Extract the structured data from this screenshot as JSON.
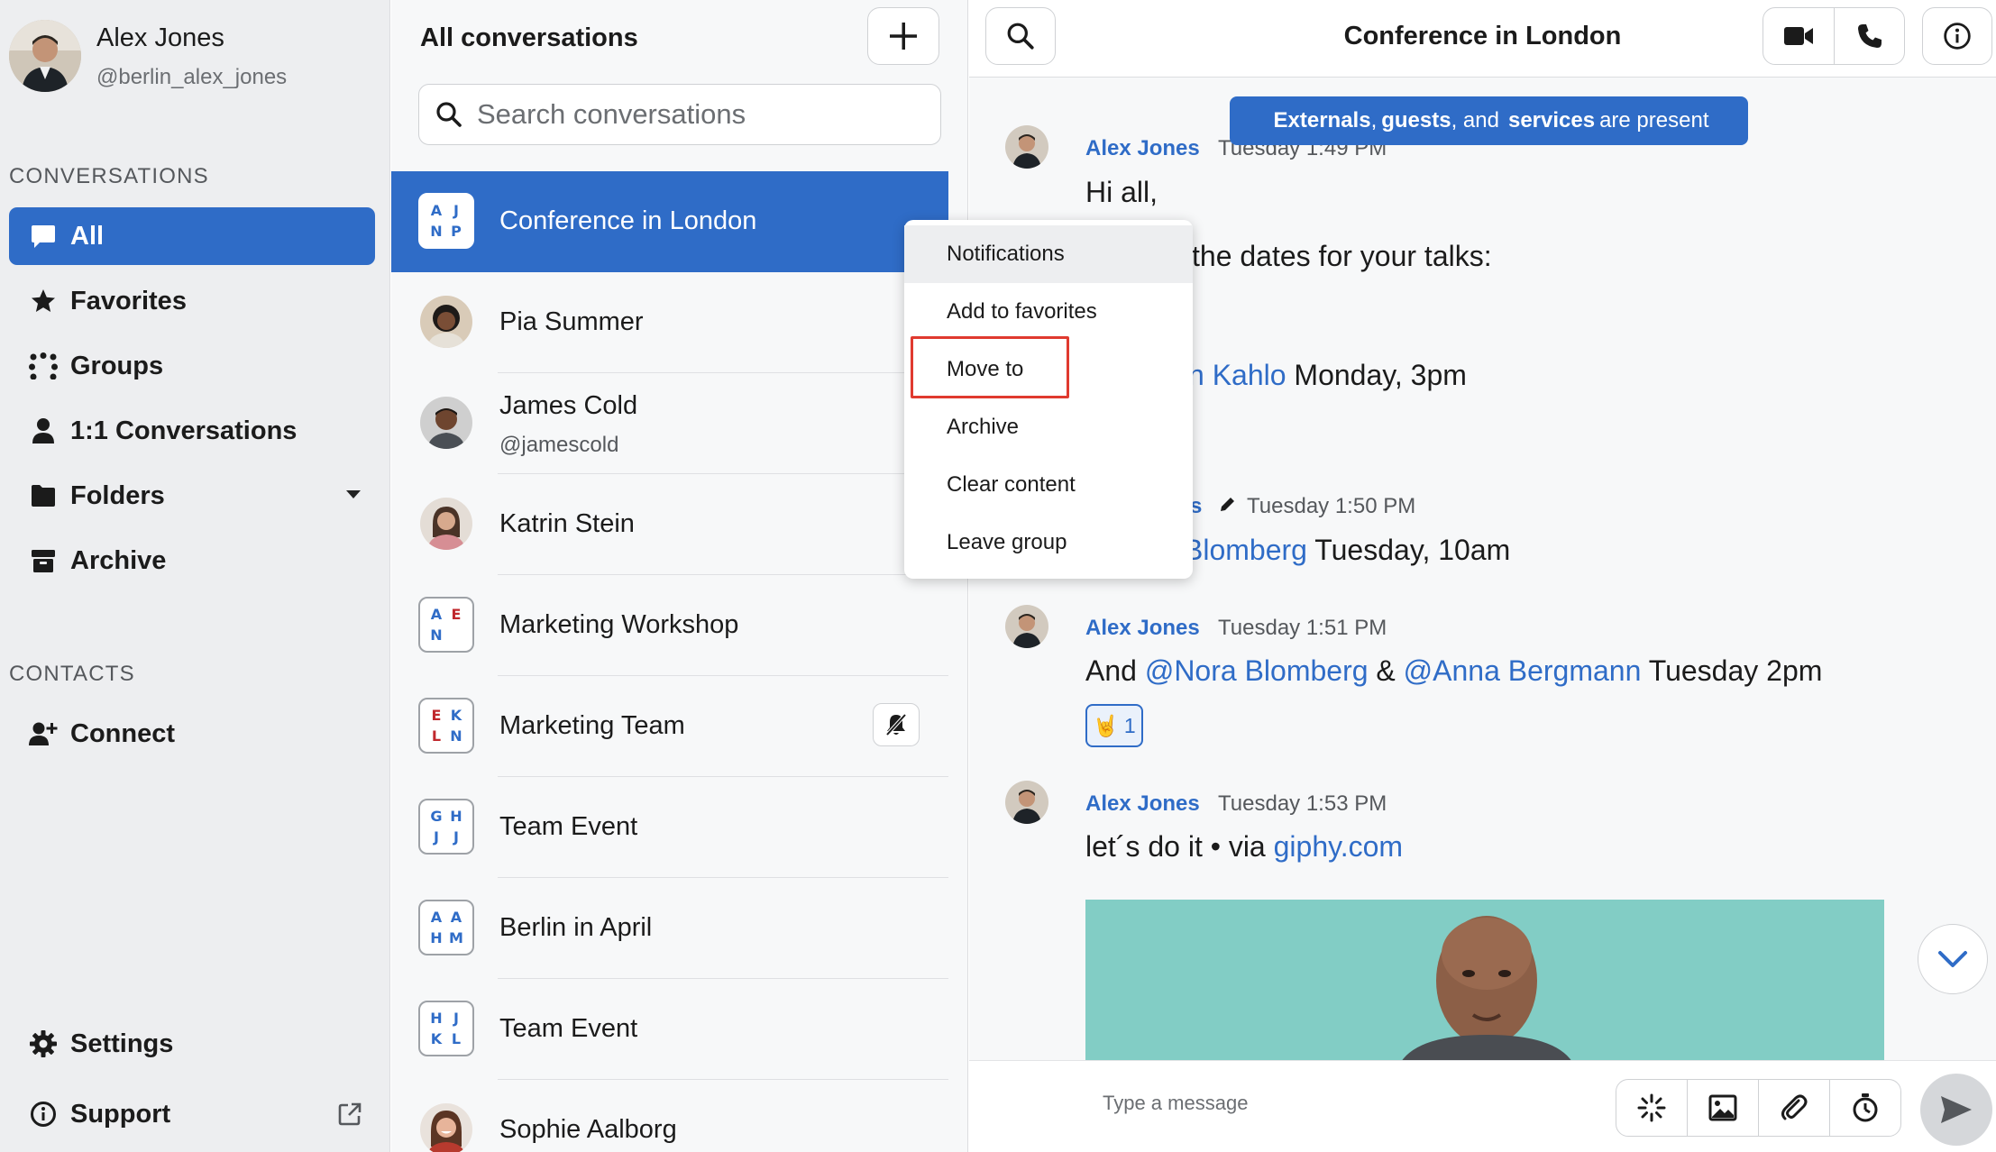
{
  "profile": {
    "name": "Alex Jones",
    "handle": "@berlin_alex_jones"
  },
  "sidebar": {
    "conversations_label": "CONVERSATIONS",
    "items": [
      {
        "label": "All",
        "icon": "chat-bubble-icon",
        "active": true
      },
      {
        "label": "Favorites",
        "icon": "star-icon"
      },
      {
        "label": "Groups",
        "icon": "groups-icon"
      },
      {
        "label": "1:1 Conversations",
        "icon": "person-icon"
      },
      {
        "label": "Folders",
        "icon": "folder-icon"
      },
      {
        "label": "Archive",
        "icon": "archive-icon"
      }
    ],
    "contacts_label": "CONTACTS",
    "connect_label": "Connect",
    "settings_label": "Settings",
    "support_label": "Support"
  },
  "list": {
    "title": "All conversations",
    "search_placeholder": "Search conversations",
    "conversations": [
      {
        "name": "Conference in London",
        "initials": [
          "A",
          "J",
          "N",
          "P"
        ],
        "active": true
      },
      {
        "name": "Pia Summer"
      },
      {
        "name": "James Cold",
        "sub": "@jamescold"
      },
      {
        "name": "Katrin Stein"
      },
      {
        "name": "Marketing Workshop",
        "initials": [
          "A",
          "E",
          "N",
          ""
        ]
      },
      {
        "name": "Marketing Team",
        "initials": [
          "E",
          "K",
          "L",
          "N"
        ],
        "muted": true
      },
      {
        "name": "Team Event",
        "initials": [
          "G",
          "H",
          "J",
          "J"
        ]
      },
      {
        "name": "Berlin in April",
        "initials": [
          "A",
          "A",
          "H",
          "M"
        ]
      },
      {
        "name": "Team Event",
        "initials": [
          "H",
          "J",
          "K",
          "L"
        ]
      },
      {
        "name": "Sophie Aalborg"
      }
    ]
  },
  "chat": {
    "title": "Conference in London",
    "banner": {
      "w1": "Externals",
      "sep1": ",",
      "w2": "guests",
      "sep2": ", and",
      "w3": "services",
      "tail": "are present"
    },
    "messages": [
      {
        "author": "Alex Jones",
        "time": "Tuesday 1:49 PM",
        "line1": "Hi all,",
        "line2": "the dates for your talks:",
        "line3_mention": "h Kahlo",
        "line3_rest": "Monday, 3pm"
      },
      {
        "author_partial": "s",
        "time": "Tuesday 1:50 PM",
        "mention": "Blomberg",
        "rest": "Tuesday, 10am"
      },
      {
        "author": "Alex Jones",
        "time": "Tuesday 1:51 PM",
        "prefix": "And",
        "mention1": "@Nora Blomberg",
        "amp": "&",
        "mention2": "@Anna Bergmann",
        "rest": "Tuesday 2pm",
        "reaction_emoji": "🤘",
        "reaction_count": "1"
      },
      {
        "author": "Alex Jones",
        "time": "Tuesday 1:53 PM",
        "text": "let´s do it • via",
        "link": "giphy.com"
      }
    ],
    "composer_placeholder": "Type a message"
  },
  "context_menu": {
    "items": [
      "Notifications",
      "Add to favorites",
      "Move to",
      "Archive",
      "Clear content",
      "Leave group"
    ],
    "hovered": "Notifications",
    "highlighted": "Move to"
  },
  "colors": {
    "accent": "#2f6cc7",
    "highlight": "#e03a2f",
    "initial_blue": "#2f6cc7",
    "initial_red": "#c0282d"
  }
}
